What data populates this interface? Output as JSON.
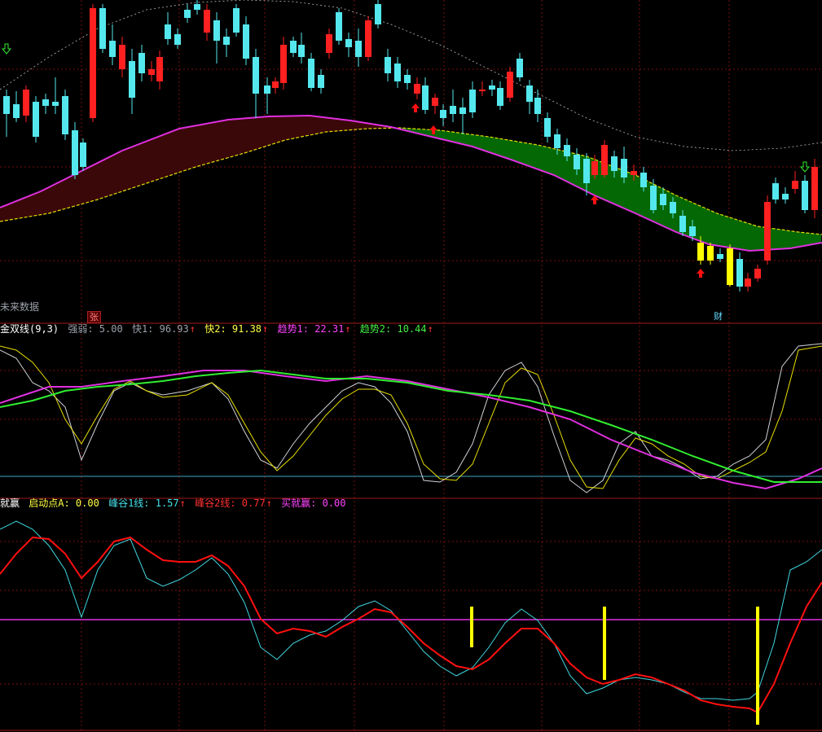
{
  "main_panel": {
    "future_data_label": "未来数据",
    "badges": {
      "zhang": "张",
      "cai": "财"
    }
  },
  "indicator1": {
    "title": "金双线(9,3)",
    "strength_label": "强弱: 5.00",
    "fast1_label": "快1: 96.93",
    "fast2_label": "快2: 91.38",
    "trend1_label": "趋势1: 22.31",
    "trend2_label": "趋势2: 10.44",
    "arrow": "↑"
  },
  "indicator2": {
    "title": "就赢",
    "start_label": "启动点A: 0.00",
    "peak1_label": "峰谷1线: 1.57",
    "peak2_label": "峰谷2线: 0.77",
    "buy_label": "买就赢: 0.00",
    "arrow": "↑"
  },
  "colors": {
    "background": "#000000",
    "up_candle": "#ff2020",
    "down_candle": "#54e8ee",
    "highlight_candle": "#ffff00",
    "grid": "#7a1010",
    "separator": "#a01818",
    "magenta_line": "#e030e0",
    "yellow_line": "#e8e000",
    "green_line": "#30ee30",
    "red_line": "#ff1010",
    "cyan_line": "#40d8e0",
    "band_dark_red": "#3a0808",
    "band_green": "#046804"
  },
  "chart_data": {
    "type": "candlestick",
    "panels": [
      "price",
      "金双线",
      "就赢"
    ],
    "indicator1_last": {
      "强弱": 5.0,
      "快1": 96.93,
      "快2": 91.38,
      "趋势1": 22.31,
      "趋势2": 10.44
    },
    "indicator2_last": {
      "启动点A": 0.0,
      "峰谷1线": 1.57,
      "峰谷2线": 0.77,
      "买就赢": 0.0
    }
  }
}
